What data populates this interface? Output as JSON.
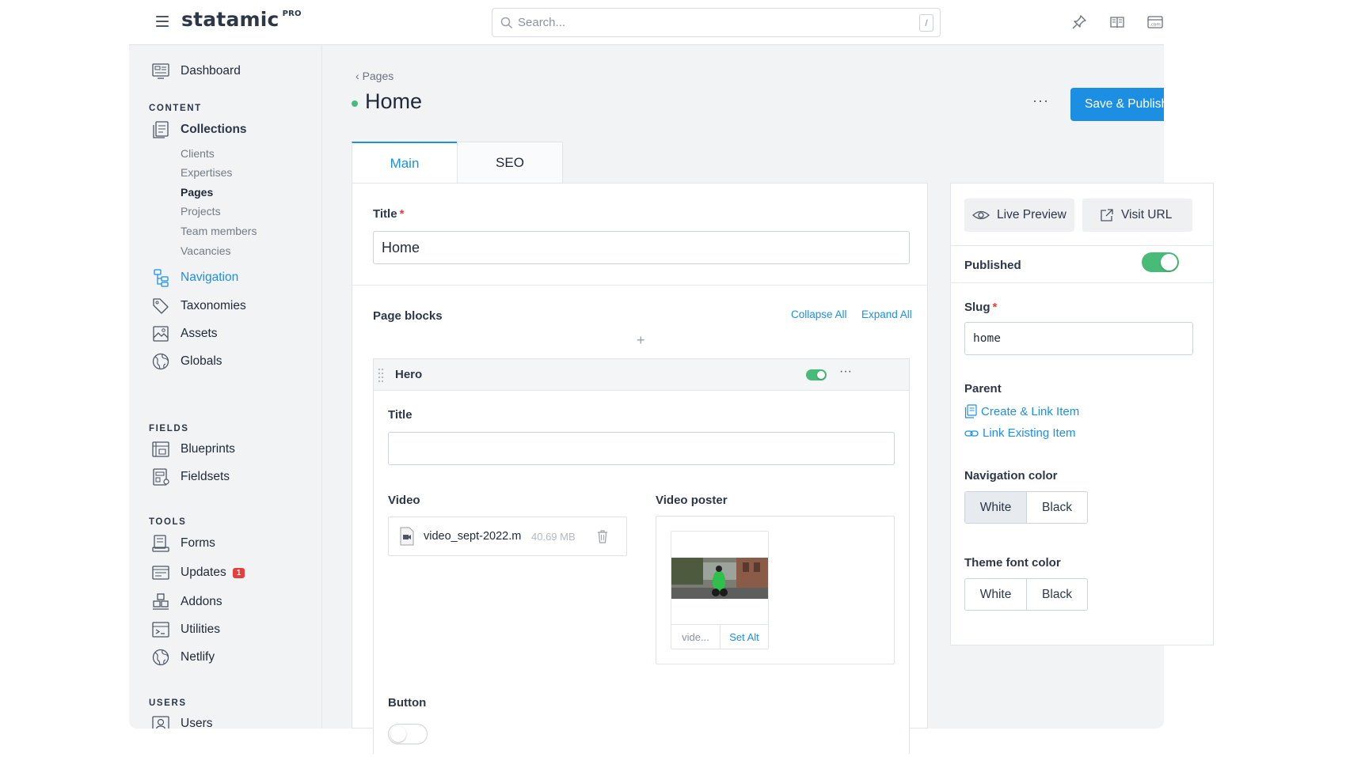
{
  "header": {
    "logo": "statamic",
    "logo_badge": "PRO",
    "search_placeholder": "Search...",
    "search_shortcut": "/"
  },
  "sidebar": {
    "dashboard": "Dashboard",
    "sections": {
      "content": "CONTENT",
      "fields": "FIELDS",
      "tools": "TOOLS",
      "users": "USERS"
    },
    "collections": "Collections",
    "collection_items": [
      "Clients",
      "Expertises",
      "Pages",
      "Projects",
      "Team members",
      "Vacancies"
    ],
    "navigation": "Navigation",
    "taxonomies": "Taxonomies",
    "assets": "Assets",
    "globals": "Globals",
    "blueprints": "Blueprints",
    "fieldsets": "Fieldsets",
    "forms": "Forms",
    "updates": "Updates",
    "updates_badge": "1",
    "addons": "Addons",
    "utilities": "Utilities",
    "netlify": "Netlify",
    "users": "Users"
  },
  "page": {
    "breadcrumb": "Pages",
    "title": "Home",
    "more": "···",
    "save_label": "Save & Publish"
  },
  "tabs": [
    "Main",
    "SEO"
  ],
  "main": {
    "title_label": "Title",
    "title_value": "Home",
    "page_blocks_label": "Page blocks",
    "collapse_all": "Collapse All",
    "expand_all": "Expand All",
    "add": "+",
    "block": {
      "name": "Hero",
      "more": "···",
      "title_label": "Title",
      "title_value": "",
      "video_label": "Video",
      "video_file": "video_sept-2022.m",
      "video_size": "40.69 MB",
      "poster_label": "Video poster",
      "poster_name": "vide...",
      "set_alt": "Set Alt",
      "button_label": "Button"
    }
  },
  "side": {
    "live_preview": "Live Preview",
    "visit_url": "Visit URL",
    "published_label": "Published",
    "slug_label": "Slug",
    "slug_value": "home",
    "parent_label": "Parent",
    "create_link": "Create & Link Item",
    "link_existing": "Link Existing Item",
    "nav_color_label": "Navigation color",
    "nav_color_options": [
      "White",
      "Black"
    ],
    "theme_font_label": "Theme font color",
    "theme_font_options": [
      "White",
      "Black"
    ]
  },
  "colors": {
    "accent": "#1d8fe3",
    "success": "#48bb78",
    "danger": "#e53e3e"
  }
}
